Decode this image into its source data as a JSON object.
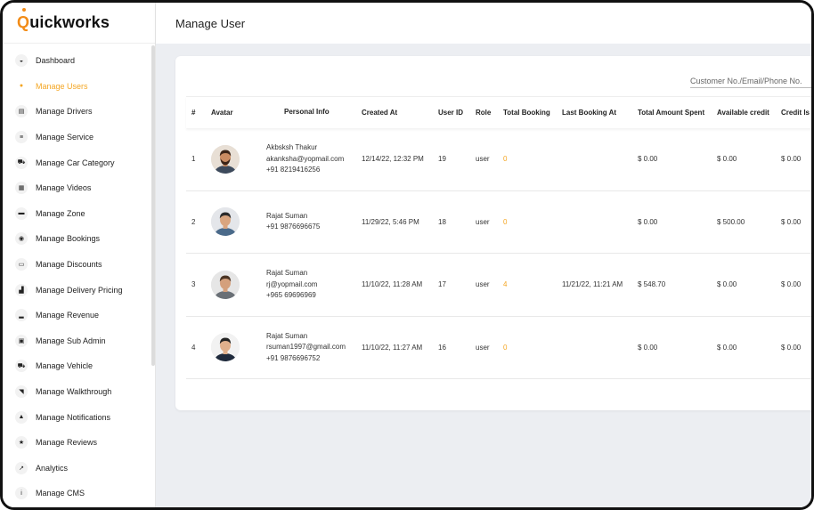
{
  "brand": {
    "prefix": "Q",
    "rest": "uickworks"
  },
  "header": {
    "title": "Manage User"
  },
  "sidebar": {
    "items": [
      {
        "label": "Dashboard",
        "icon": "dashboard-icon",
        "glyph": "◒",
        "active": false
      },
      {
        "label": "Manage Users",
        "icon": "user-icon",
        "glyph": "●",
        "active": true
      },
      {
        "label": "Manage Drivers",
        "icon": "id-card-icon",
        "glyph": "▤",
        "active": false
      },
      {
        "label": "Manage Service",
        "icon": "list-icon",
        "glyph": "≡",
        "active": false
      },
      {
        "label": "Manage Car Category",
        "icon": "car-icon",
        "glyph": "⛟",
        "active": false
      },
      {
        "label": "Manage Videos",
        "icon": "calendar-icon",
        "glyph": "▦",
        "active": false
      },
      {
        "label": "Manage Zone",
        "icon": "briefcase-icon",
        "glyph": "▬",
        "active": false
      },
      {
        "label": "Manage Bookings",
        "icon": "target-icon",
        "glyph": "◉",
        "active": false
      },
      {
        "label": "Manage Discounts",
        "icon": "image-icon",
        "glyph": "▭",
        "active": false
      },
      {
        "label": "Manage Delivery Pricing",
        "icon": "chart-icon",
        "glyph": "▟",
        "active": false
      },
      {
        "label": "Manage Revenue",
        "icon": "signal-icon",
        "glyph": "▂",
        "active": false
      },
      {
        "label": "Manage Sub Admin",
        "icon": "lock-icon",
        "glyph": "▣",
        "active": false
      },
      {
        "label": "Manage Vehicle",
        "icon": "vehicle-icon",
        "glyph": "⛟",
        "active": false
      },
      {
        "label": "Manage Walkthrough",
        "icon": "megaphone-icon",
        "glyph": "◥",
        "active": false
      },
      {
        "label": "Manage Notifications",
        "icon": "bell-icon",
        "glyph": "▲",
        "active": false
      },
      {
        "label": "Manage Reviews",
        "icon": "star-icon",
        "glyph": "★",
        "active": false
      },
      {
        "label": "Analytics",
        "icon": "trend-icon",
        "glyph": "↗",
        "active": false
      },
      {
        "label": "Manage CMS",
        "icon": "info-icon",
        "glyph": "i",
        "active": false
      }
    ]
  },
  "search": {
    "placeholder": "Customer No./Email/Phone No."
  },
  "table": {
    "headers": {
      "num": "#",
      "avatar": "Avatar",
      "info": "Personal Info",
      "created": "Created At",
      "uid": "User ID",
      "role": "Role",
      "booking": "Total Booking",
      "last": "Last Booking At",
      "spent": "Total Amount Spent",
      "credit": "Available credit",
      "credit_issued": "Credit Is"
    },
    "rows": [
      {
        "num": "1",
        "name": "Akbsksh Thakur",
        "email": "akanksha@yopmail.com",
        "phone": "+91 8219416256",
        "created": "12/14/22, 12:32 PM",
        "uid": "19",
        "role": "user",
        "booking": "0",
        "last": "",
        "spent": "$ 0.00",
        "credit": "$ 0.00",
        "credit_issued": "$ 0.00"
      },
      {
        "num": "2",
        "name": "Rajat Suman",
        "email": "",
        "phone": "+91 9876696675",
        "created": "11/29/22, 5:46 PM",
        "uid": "18",
        "role": "user",
        "booking": "0",
        "last": "",
        "spent": "$ 0.00",
        "credit": "$ 500.00",
        "credit_issued": "$ 0.00"
      },
      {
        "num": "3",
        "name": "Rajat Suman",
        "email": "rj@yopmail.com",
        "phone": "+965 69696969",
        "created": "11/10/22, 11:28 AM",
        "uid": "17",
        "role": "user",
        "booking": "4",
        "last": "11/21/22, 11:21 AM",
        "spent": "$ 548.70",
        "credit": "$ 0.00",
        "credit_issued": "$ 0.00"
      },
      {
        "num": "4",
        "name": "Rajat Suman",
        "email": "rsuman1997@gmail.com",
        "phone": "+91 9876696752",
        "created": "11/10/22, 11:27 AM",
        "uid": "16",
        "role": "user",
        "booking": "0",
        "last": "",
        "spent": "$ 0.00",
        "credit": "$ 0.00",
        "credit_issued": "$ 0.00"
      }
    ]
  },
  "colors": {
    "accent": "#f4a623",
    "background": "#eceef2"
  }
}
